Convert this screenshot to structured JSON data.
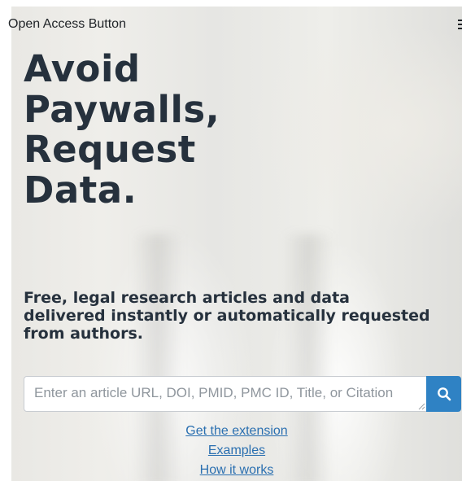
{
  "header": {
    "brand": "Open Access Button"
  },
  "hero": {
    "headline_lines": [
      "Avoid",
      "Paywalls,",
      "Request",
      "Data."
    ],
    "subhead_lines": [
      "Free, legal research articles and data",
      "delivered instantly or automatically requested",
      "from authors."
    ]
  },
  "search": {
    "placeholder": "Enter an article URL, DOI, PMID, PMC ID, Title, or Citation",
    "value": "",
    "button_icon": "search-icon"
  },
  "links": {
    "get_extension": "Get the extension",
    "examples": "Examples",
    "how_it_works": "How it works"
  },
  "colors": {
    "headline": "#26313d",
    "accent": "#2f82c4",
    "link": "#2a6fb0"
  }
}
